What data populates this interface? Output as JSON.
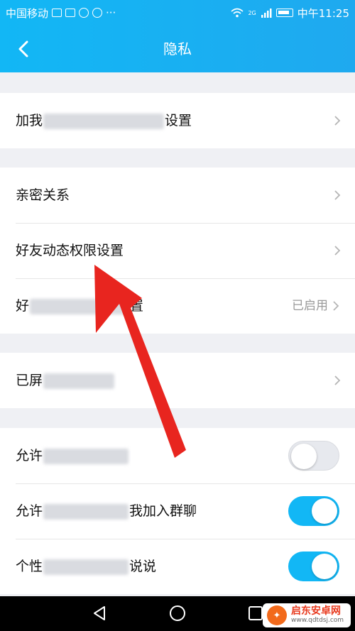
{
  "statusbar": {
    "carrier": "中国移动",
    "more": "···",
    "network": "2G",
    "time": "中午11:25"
  },
  "header": {
    "title": "隐私"
  },
  "groups": [
    {
      "rows": [
        {
          "label_prefix": "加我",
          "label_suffix": "设置"
        }
      ]
    },
    {
      "rows": [
        {
          "label": "亲密关系"
        },
        {
          "label": "好友动态权限设置"
        },
        {
          "label_prefix": "好",
          "label_suffix": "置",
          "value": "已启用"
        }
      ]
    },
    {
      "rows": [
        {
          "label_prefix": "已屏"
        }
      ]
    },
    {
      "rows": [
        {
          "label_prefix": "允许",
          "toggle": false
        },
        {
          "label_prefix": "允许",
          "label_suffix": "我加入群聊",
          "toggle": true
        },
        {
          "label_prefix": "个性",
          "label_suffix": "说说",
          "toggle": true
        }
      ]
    }
  ],
  "watermark": {
    "name": "启东安卓网",
    "url": "www.qdtdsj.com"
  },
  "colors": {
    "accent": "#12b7f5",
    "annotation_arrow": "#e8251f",
    "background": "#eff0f4"
  }
}
